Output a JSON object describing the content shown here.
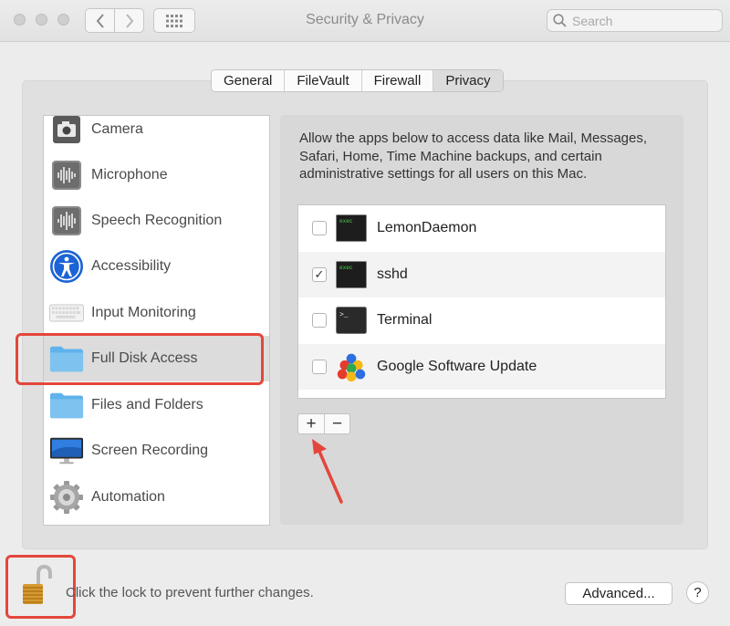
{
  "window": {
    "title": "Security & Privacy"
  },
  "search": {
    "placeholder": "Search",
    "icon": "magnifier-icon"
  },
  "tabs": [
    {
      "label": "General",
      "selected": false
    },
    {
      "label": "FileVault",
      "selected": false
    },
    {
      "label": "Firewall",
      "selected": false
    },
    {
      "label": "Privacy",
      "selected": true
    }
  ],
  "sidebar": {
    "items": [
      {
        "label": "Camera",
        "icon": "camera-icon"
      },
      {
        "label": "Microphone",
        "icon": "microphone-icon"
      },
      {
        "label": "Speech Recognition",
        "icon": "speech-recognition-icon"
      },
      {
        "label": "Accessibility",
        "icon": "accessibility-icon"
      },
      {
        "label": "Input Monitoring",
        "icon": "keyboard-icon"
      },
      {
        "label": "Full Disk Access",
        "icon": "folder-icon",
        "selected": true
      },
      {
        "label": "Files and Folders",
        "icon": "folder-icon"
      },
      {
        "label": "Screen Recording",
        "icon": "display-icon"
      },
      {
        "label": "Automation",
        "icon": "gear-icon"
      }
    ]
  },
  "description": "Allow the apps below to access data like Mail, Messages, Safari, Home, Time Machine backups, and certain administrative settings for all users on this Mac.",
  "apps": [
    {
      "name": "LemonDaemon",
      "checked": false,
      "icon": "exec-icon"
    },
    {
      "name": "sshd",
      "checked": true,
      "icon": "exec-icon"
    },
    {
      "name": "Terminal",
      "checked": false,
      "icon": "terminal-icon"
    },
    {
      "name": "Google Software Update",
      "checked": false,
      "icon": "google-update-icon"
    }
  ],
  "app_icon_text": {
    "exec": "exec",
    "terminal": ">_"
  },
  "check_glyph": "✓",
  "buttons": {
    "add": "+",
    "remove": "−",
    "advanced": "Advanced...",
    "help": "?"
  },
  "lock": {
    "text": "Click the lock to prevent further changes.",
    "state": "unlocked"
  },
  "colors": {
    "annotation": "#e4463c",
    "folder": "#7ec3ef"
  }
}
